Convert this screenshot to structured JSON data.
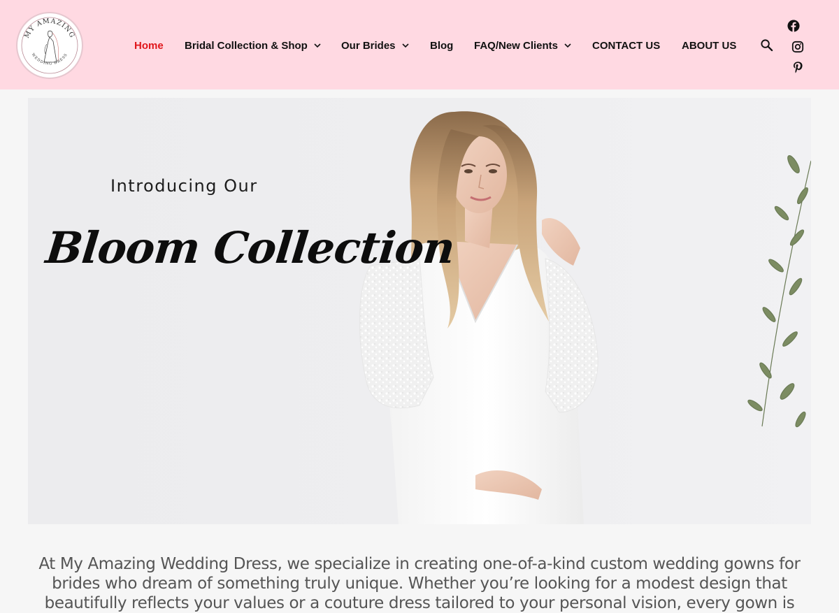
{
  "header": {
    "logo": {
      "text_top": "MY AMAZING",
      "text_bottom": "WEDDING DRESS"
    },
    "nav": [
      {
        "label": "Home",
        "active": true,
        "has_dropdown": false
      },
      {
        "label": "Bridal Collection & Shop",
        "active": false,
        "has_dropdown": true
      },
      {
        "label": "Our Brides",
        "active": false,
        "has_dropdown": true
      },
      {
        "label": "Blog",
        "active": false,
        "has_dropdown": false
      },
      {
        "label": "FAQ/New Clients",
        "active": false,
        "has_dropdown": true
      },
      {
        "label": "CONTACT US",
        "active": false,
        "has_dropdown": false
      },
      {
        "label": "ABOUT US",
        "active": false,
        "has_dropdown": false
      }
    ],
    "icons": {
      "search": "search-icon",
      "social": [
        "facebook-icon",
        "instagram-icon",
        "pinterest-icon"
      ]
    }
  },
  "hero": {
    "intro": "Introducing Our",
    "title": "Bloom Collection"
  },
  "intro_paragraph": "At My Amazing Wedding Dress, we specialize in creating one-of-a-kind custom wedding gowns for brides who dream of something truly unique. Whether you’re looking for a modest design that beautifully reflects your values or a couture dress tailored to your personal vision, every gown is",
  "colors": {
    "header_bg": "#ffd9e2",
    "active_nav": "#e0161b",
    "page_bg": "#f6f6f6",
    "text": "#111111"
  }
}
